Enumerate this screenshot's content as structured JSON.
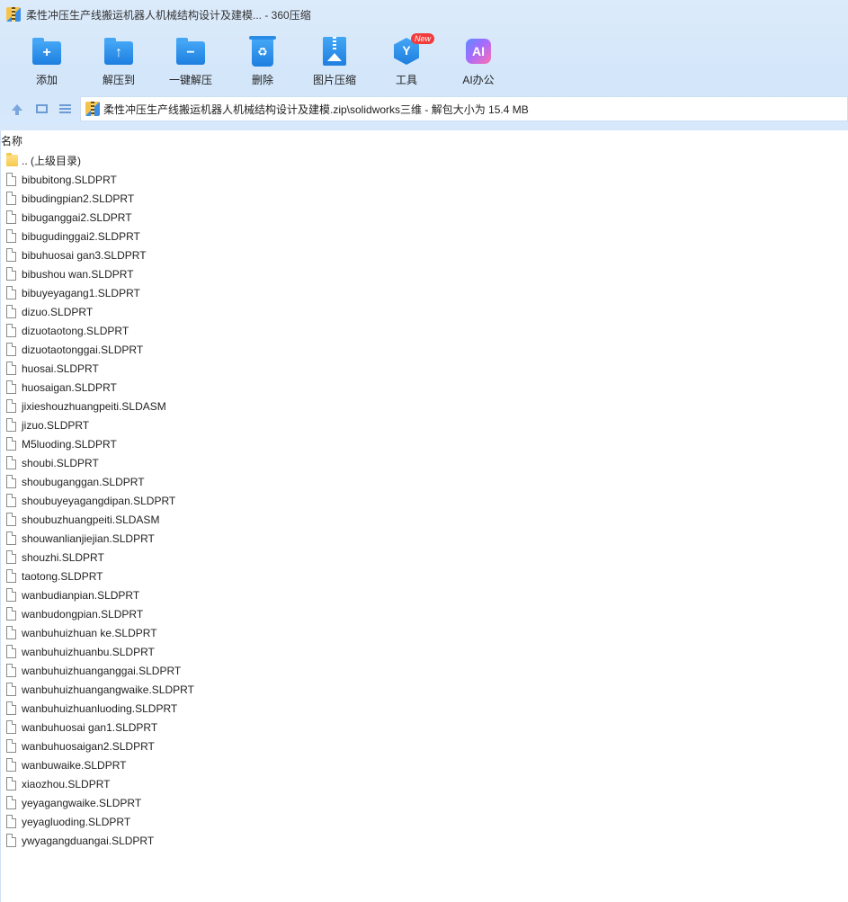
{
  "window": {
    "title": "柔性冲压生产线搬运机器人机械结构设计及建模... - 360压缩"
  },
  "toolbar": {
    "add": "添加",
    "extract_to": "解压到",
    "one_click_extract": "一键解压",
    "delete": "删除",
    "image_compress": "图片压缩",
    "tools": "工具",
    "tools_badge": "New",
    "ai_office": "AI办公",
    "ai_glyph": "AI"
  },
  "address": {
    "path": "柔性冲压生产线搬运机器人机械结构设计及建模.zip\\solidworks三维 - 解包大小为 15.4 MB"
  },
  "list": {
    "column_name": "名称",
    "parent": ".. (上级目录)",
    "files": [
      "bibubitong.SLDPRT",
      "bibudingpian2.SLDPRT",
      "bibuganggai2.SLDPRT",
      "bibugudinggai2.SLDPRT",
      "bibuhuosai gan3.SLDPRT",
      "bibushou wan.SLDPRT",
      "bibuyeyagang1.SLDPRT",
      "dizuo.SLDPRT",
      "dizuotaotong.SLDPRT",
      "dizuotaotonggai.SLDPRT",
      "huosai.SLDPRT",
      "huosaigan.SLDPRT",
      "jixieshouzhuangpeiti.SLDASM",
      "jizuo.SLDPRT",
      "M5luoding.SLDPRT",
      "shoubi.SLDPRT",
      "shoubuganggan.SLDPRT",
      "shoubuyeyagangdipan.SLDPRT",
      "shoubuzhuangpeiti.SLDASM",
      "shouwanlianjiejian.SLDPRT",
      "shouzhi.SLDPRT",
      "taotong.SLDPRT",
      "wanbudianpian.SLDPRT",
      "wanbudongpian.SLDPRT",
      "wanbuhuizhuan ke.SLDPRT",
      "wanbuhuizhuanbu.SLDPRT",
      "wanbuhuizhuanganggai.SLDPRT",
      "wanbuhuizhuangangwaike.SLDPRT",
      "wanbuhuizhuanluoding.SLDPRT",
      "wanbuhuosai gan1.SLDPRT",
      "wanbuhuosaigan2.SLDPRT",
      "wanbuwaike.SLDPRT",
      "xiaozhou.SLDPRT",
      "yeyagangwaike.SLDPRT",
      "yeyagluoding.SLDPRT",
      "ywyagangduangai.SLDPRT"
    ]
  }
}
